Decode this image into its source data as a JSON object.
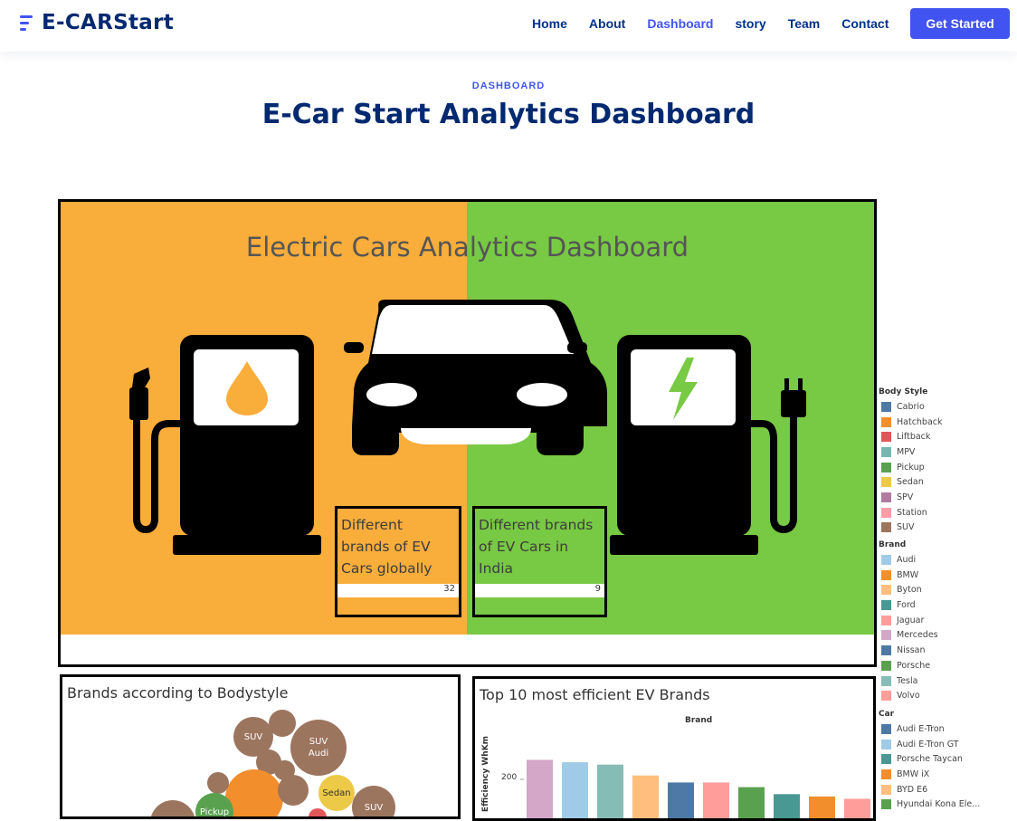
{
  "header": {
    "logo": "E-CARStart",
    "nav": [
      "Home",
      "About",
      "Dashboard",
      "story",
      "Team",
      "Contact"
    ],
    "cta": "Get Started",
    "active": "Dashboard"
  },
  "section": {
    "subtitle": "DASHBOARD",
    "title": "E-Car Start Analytics Dashboard"
  },
  "dashboard": {
    "title": "Electric Cars Analytics Dashboard",
    "kpi_global": {
      "label": "Different brands of EV Cars globally",
      "value": "32"
    },
    "kpi_india": {
      "label": "Different brands of EV Cars in India",
      "value": "9"
    }
  },
  "legend": {
    "body_style_title": "Body Style",
    "body_style": [
      {
        "name": "Cabrio",
        "color": "#4e79a7"
      },
      {
        "name": "Hatchback",
        "color": "#f28e2b"
      },
      {
        "name": "Liftback",
        "color": "#e15759"
      },
      {
        "name": "MPV",
        "color": "#76b7b2"
      },
      {
        "name": "Pickup",
        "color": "#59a14f"
      },
      {
        "name": "Sedan",
        "color": "#edc948"
      },
      {
        "name": "SPV",
        "color": "#b07aa1"
      },
      {
        "name": "Station",
        "color": "#ff9da7"
      },
      {
        "name": "SUV",
        "color": "#9c755f"
      }
    ],
    "brand_title": "Brand",
    "brand": [
      {
        "name": "Audi",
        "color": "#a0cbe8"
      },
      {
        "name": "BMW",
        "color": "#f28e2b"
      },
      {
        "name": "Byton",
        "color": "#ffbe7d"
      },
      {
        "name": "Ford",
        "color": "#499894"
      },
      {
        "name": "Jaguar",
        "color": "#ff9d9a"
      },
      {
        "name": "Mercedes",
        "color": "#d4a6c8"
      },
      {
        "name": "Nissan",
        "color": "#4e79a7"
      },
      {
        "name": "Porsche",
        "color": "#59a14f"
      },
      {
        "name": "Tesla",
        "color": "#86bcb6"
      },
      {
        "name": "Volvo",
        "color": "#ff9d9a"
      }
    ],
    "car_title": "Car",
    "car": [
      {
        "name": "Audi E-Tron",
        "color": "#4e79a7"
      },
      {
        "name": "Audi E-Tron GT",
        "color": "#a0cbe8"
      },
      {
        "name": "Porsche Taycan",
        "color": "#499894"
      },
      {
        "name": "BMW iX",
        "color": "#f28e2b"
      },
      {
        "name": "BYD E6",
        "color": "#ffbe7d"
      },
      {
        "name": "Hyundai Kona Ele...",
        "color": "#59a14f"
      }
    ]
  },
  "panel_bubble": {
    "title": "Brands according to Bodystyle",
    "bubbles": [
      {
        "label": "SUV",
        "sub": "",
        "color": "#9c755f"
      },
      {
        "label": "SUV",
        "sub": "Audi",
        "color": "#9c755f"
      },
      {
        "label": "Sedan",
        "sub": "",
        "color": "#edc948"
      },
      {
        "label": "SUV",
        "sub": "",
        "color": "#9c755f"
      },
      {
        "label": "Pickup",
        "sub": "",
        "color": "#59a14f"
      }
    ]
  },
  "panel_bar": {
    "title": "Top 10 most efficient EV Brands",
    "legend_label": "Brand",
    "ylabel": "Efficiency WhKm",
    "ytick": "200",
    "chart_data": {
      "type": "bar",
      "series_colors": [
        "#d4a6c8",
        "#a0cbe8",
        "#86bcb6",
        "#ffbe7d",
        "#4e79a7",
        "#ff9d9a",
        "#59a14f",
        "#499894",
        "#f28e2b",
        "#ff9d9a"
      ],
      "values": [
        225,
        222,
        219,
        205,
        196,
        196,
        190,
        181,
        178,
        175
      ],
      "ytick_value": 200
    }
  }
}
